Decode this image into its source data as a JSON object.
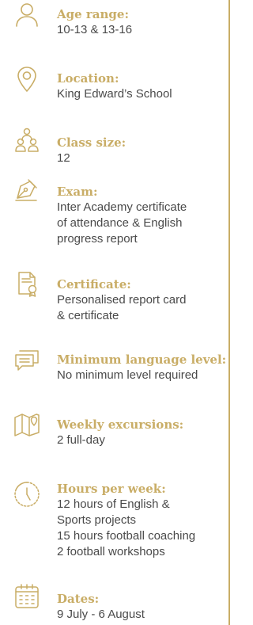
{
  "accent_color": "#c9ad66",
  "text_color": "#4a4a4a",
  "items": [
    {
      "icon": "person-icon",
      "label": "Age range:",
      "lines": [
        "10-13 & 13-16"
      ]
    },
    {
      "icon": "location-pin-icon",
      "label": "Location:",
      "lines": [
        "King Edward’s School"
      ]
    },
    {
      "icon": "group-icon",
      "label": "Class size:",
      "lines": [
        "12"
      ]
    },
    {
      "icon": "pen-nib-icon",
      "label": "Exam:",
      "lines": [
        "Inter Academy certificate",
        "of attendance & English",
        "progress report"
      ]
    },
    {
      "icon": "certificate-icon",
      "label": "Certificate:",
      "lines": [
        "Personalised report card",
        "& certificate"
      ]
    },
    {
      "icon": "speech-bubbles-icon",
      "label": "Minimum language level:",
      "lines": [
        "No minimum level required"
      ]
    },
    {
      "icon": "map-icon",
      "label": "Weekly excursions:",
      "lines": [
        "2 full-day"
      ]
    },
    {
      "icon": "clock-icon",
      "label": "Hours per week:",
      "lines": [
        "12 hours of English &",
        "Sports projects",
        "15 hours football coaching",
        "2 football workshops"
      ]
    },
    {
      "icon": "calendar-icon",
      "label": "Dates:",
      "lines": [
        "9 July - 6 August"
      ]
    }
  ]
}
